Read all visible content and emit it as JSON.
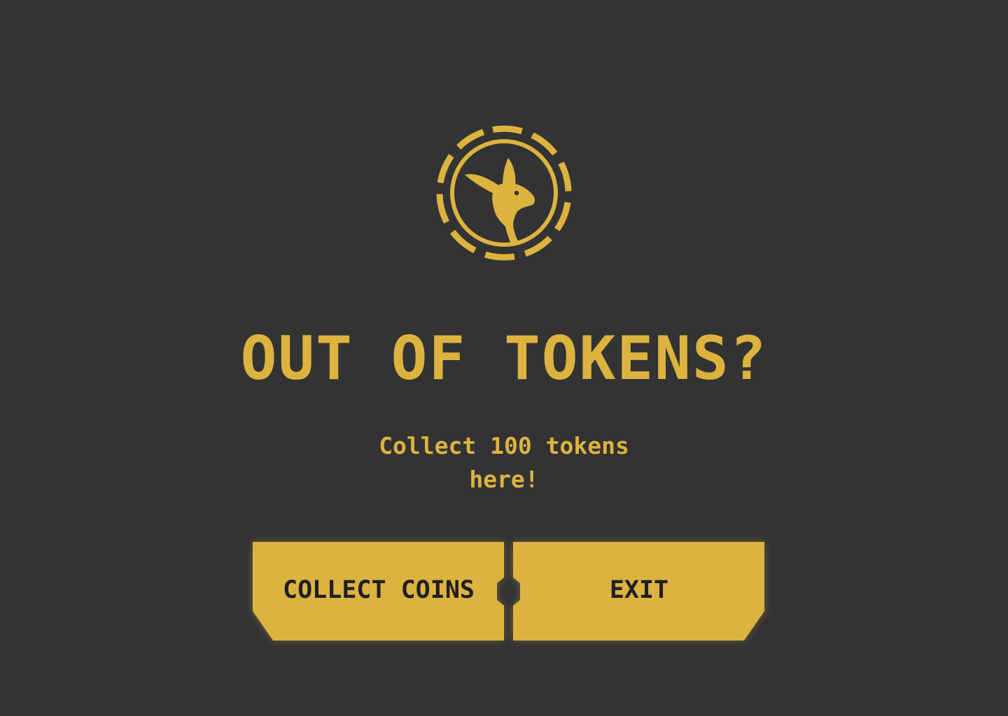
{
  "dialog": {
    "logo_icon": "kangaroo-token-chip-icon",
    "title": "OUT OF TOKENS?",
    "subtitle_line1": "Collect 100 tokens",
    "subtitle_line2": "here!"
  },
  "buttons": {
    "collect_label": "COLLECT COINS",
    "exit_label": "EXIT"
  },
  "colors": {
    "background": "#333333",
    "accent": "#DCB33F",
    "button_text": "#1f1f1f"
  }
}
